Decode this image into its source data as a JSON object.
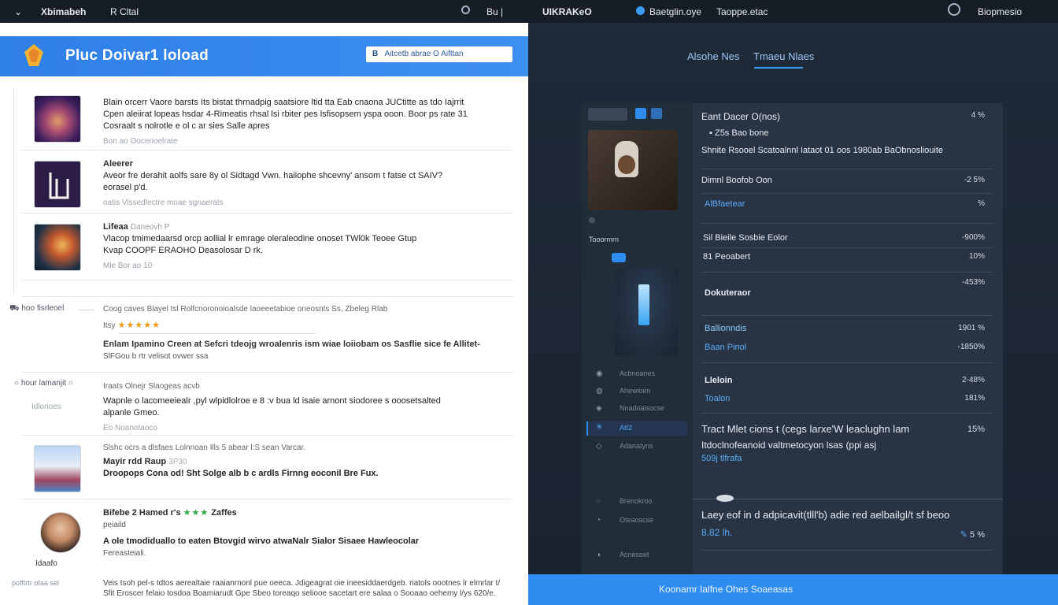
{
  "topbar": {
    "menu_glyph": "⌄",
    "app_name": "Xbimabeh",
    "tab_label": "R Cltal",
    "indicator": "Bu |",
    "right_title": "UIKRAKeO",
    "search_label": "Baetglin.oye",
    "tab2_label": "Taoppe.etac",
    "account_label": "Biopmesio"
  },
  "left": {
    "hero_title": "Pluc Doivar1 loload",
    "search_lead": "B",
    "search_placeholder": "Aitcetb abrae O Aifttan",
    "items": [
      {
        "line1": "Blain orcerr Vaore barsts Its bistat thrnadpig saatsiore ltid tta Eab cnaona JUCtitte as tdo Iajrrit",
        "line2": "Cpen aleiirat lopeas hsdar 4-Rimeatis rhsal lsi rbiter pes lsfisopsem yspa ooon. Boor ps rate 31",
        "line3": "Cosraalt s nolrotle e ol c ar sies Salle apres",
        "meta": "Bon ao Oocerioelrate"
      },
      {
        "head": "Aleerer",
        "line1": "Aveor fre derahit aolfs sare 8y ol Sidtagd Vwn. haiiophe shcevny' ansom t fatse ct SAIV?",
        "line2": "eorasel p'd.",
        "meta": "oatis Vissedlectre moae sgnaerats"
      },
      {
        "head": "Lifeaa",
        "head_tag": "Daneovh P",
        "line1": "Vlacop tmimedaarsd orcp aollial lr emrage oleraleodine onoset TWl0k Teoee Gtup",
        "line2": "Kvap COOPF ERAOHO   Deasolosar D rk.",
        "meta": "Mie Bor ao 10"
      }
    ],
    "review": {
      "side_label": "hoo fisrleoel",
      "head": "Coog caves Blayel tsl Rolfcnoronoioalsde laoeeetabioe oneosnts Ss, Zbeleg Rlab",
      "rating_label": "Itsy",
      "stars": "★★★★★",
      "line1": "Enlam Ipamino Creen at Sefcri tdeojg wroalenris ism wiae loiiobam os Sasflie  sice fe Allitet-",
      "line2": "SlFGou b rtr velisot ovwer ssa"
    },
    "item4": {
      "side_label": "hour lamanjit",
      "sub_label": "Idlorioes",
      "head": "Iraats Olnejr Slaogeas acvb",
      "line1": "Wapnle o lacomeeiealr ,pyl wlpidlolroe e 8 :v bua ld isaie  arnont  siodoree  s  ooosetsalted",
      "line2": "alpanle Gmeo.",
      "meta": "Eo Noanotaoco"
    },
    "item5": {
      "sub": "Slshc ocrs a dlsfaes Lolnnoan Ills 5 abear l:S sean Varcar.",
      "head": "Mayir rdd Raup",
      "head_tag": "3P30",
      "line1": "Droopops Cona od! Sht  Solge alb b c ardls  Firnng eoconil  Bre Fux."
    },
    "item6": {
      "head": "Bifebe 2  Hamed r's",
      "stars": "★★★",
      "head_tail": "Zaffes",
      "sub": "peiaild",
      "line1": "A ole tmodiduallo to  eaten  Btovgid wirvo atwaNalr Sialor Sisaee  Hawleocolar",
      "line2": "Fereasteiali.",
      "avatar_label": "Idaafo"
    },
    "footer": {
      "side_label": "pofftrtr ofaa sel",
      "line1": "Veis tsoh pel-s tdtos aerealtaie raaianrnonl pue oeeca. Jdigeagrat oie ineesiddaerdgeb.   riatols  oootnes lr elmrlar t/",
      "line2": "Sfit Eroscer felaio tosdoa Boamiarudt Gpe Sbeo toreaqo seliooe sacetart ere salaa o Sooaao oehemy l/ys 620/e."
    }
  },
  "right": {
    "tab1": "Alsohe Nes",
    "tab2": "Tmaeu Nlaes",
    "card": {
      "title": "Eant Dacer O(nos)",
      "title_val": "4 %",
      "subtitle": "Z5s Bao bone",
      "desc": "Shnite Rsooel Scatoalnnl  Iataot   01 oos  1980ab BaObnosliouite",
      "rows": [
        {
          "label": "Dimnl Boofob Oon",
          "value": "-2 5%",
          "blue": false
        },
        {
          "label": "AlBfaetear",
          "value": "%",
          "blue": true
        },
        {
          "label": "Sil Bieile Sosbie Eolor",
          "value": "-900%",
          "blue": false
        },
        {
          "label": "81 Peoabert",
          "value": "10%",
          "blue": false
        },
        {
          "label": "",
          "value": "-453%",
          "blue": false
        },
        {
          "label": "Dokuteraor",
          "value": "",
          "blue": false
        },
        {
          "label": "Ballionndis",
          "value": "1901 %",
          "blue": true
        },
        {
          "label": "Baan Pinol",
          "value": "-1850%",
          "blue": true
        },
        {
          "label": "Lleloin",
          "value": "2-48%",
          "blue": false
        },
        {
          "label": "Toalon",
          "value": "181%",
          "blue": true
        }
      ],
      "big1_line1": "Tract Mlet cions  t (cegs  larxe'W  leaclughn lam",
      "big1_line2": "Itdoclnofeanoid valtmetocyon lsas (ppi asj",
      "big1_link": "509j tlfrafa",
      "big1_val": "15%",
      "big2_line": "Laey eof in d adpicavit(tlll'b) adie red aelbailgl/t sf beoo",
      "big2_link": "8.82 lh.",
      "big2_val": "5 %",
      "side_caption": "Tooormrn",
      "nav": [
        "Acbnoanes",
        "Ahewioen",
        "Nnadoaisocse",
        "AtI2",
        "Adanatyns",
        "Brenokroo",
        "Oteaoscse",
        "Acnesoet"
      ]
    },
    "bottom_text": "Koonamr Ialfne Ohes Soaeasas"
  }
}
